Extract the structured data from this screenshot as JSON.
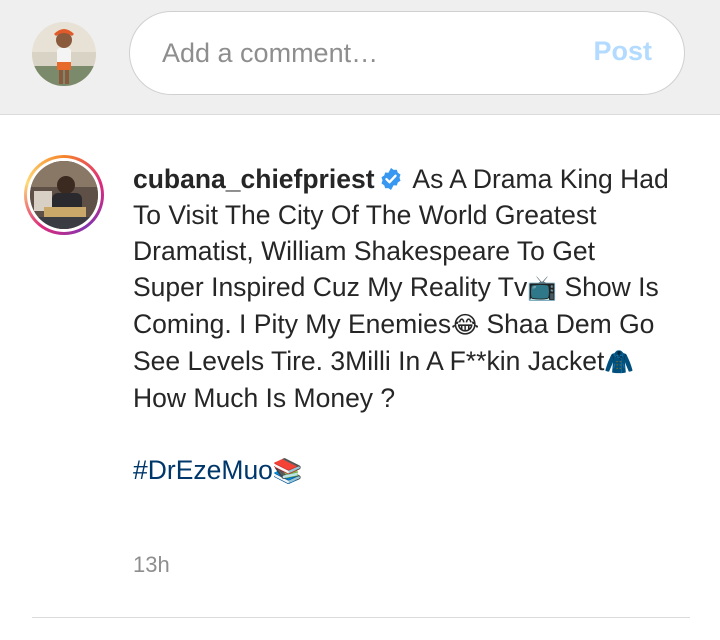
{
  "comment_bar": {
    "avatar_icon": "user-avatar-photo",
    "input_placeholder": "Add a comment…",
    "input_value": "",
    "post_label": "Post",
    "post_color": "#b3dbff"
  },
  "post": {
    "avatar_icon": "author-avatar-photo",
    "username": "cubana_chiefpriest",
    "verified_icon": "verified-badge-icon",
    "verified_color": "#3897f0",
    "caption_parts": [
      " As A Drama King Had To Visit The City Of The World Greatest Dramatist, William Shakespeare To Get Super Inspired Cuz My Reality Tv",
      "📺",
      " Show Is Coming. I Pity My Enemies",
      "😂",
      " Shaa Dem Go See Levels Tire. 3Milli In A F**kin Jacket",
      "🧥",
      " How Much Is Money ?"
    ],
    "hashtag": "#DrEzeMuo",
    "hashtag_emoji": "📚",
    "hashtag_color": "#00376b",
    "timestamp": "13h"
  }
}
